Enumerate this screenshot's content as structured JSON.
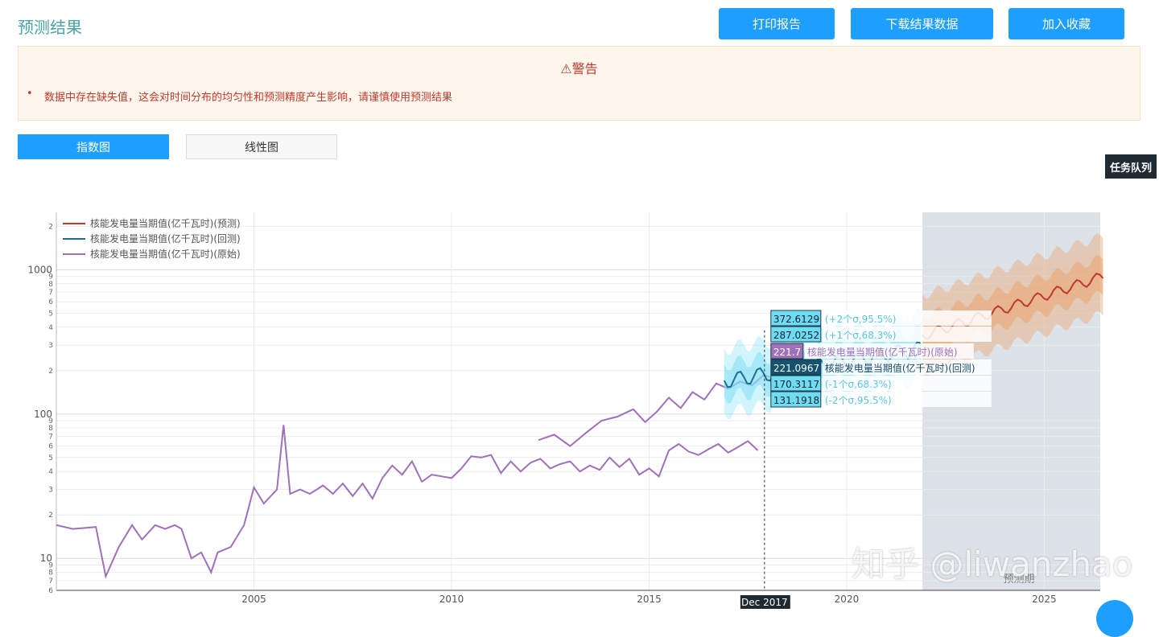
{
  "page": {
    "title": "预测结果",
    "buttons": {
      "print": "打印报告",
      "download": "下载结果数据",
      "favorite": "加入收藏"
    },
    "alert": {
      "title": "⚠警告",
      "message": "数据中存在缺失值，这会对时间分布的均匀性和预测精度产生影响，请谨慎使用预测结果"
    },
    "tabs": {
      "log": "指数图",
      "linear": "线性图"
    },
    "task_queue": "任务队列",
    "watermark": "知乎 @liwanzhao"
  },
  "colors": {
    "accent": "#1e9fff",
    "forecast": "#c0392b",
    "backtest": "#1a6f8f",
    "original": "#a070b8",
    "band_blue": "#7fe0f5",
    "band_orange": "#e9a877",
    "forecast_region": "#dde2e8"
  },
  "chart_data": {
    "type": "line",
    "y_scale": "log",
    "ylim": [
      6,
      2500
    ],
    "xlim": [
      "2000-01",
      "2026-06"
    ],
    "x_ticks": [
      "2005",
      "2010",
      "2015",
      "2020",
      "2025"
    ],
    "y_major_ticks": [
      {
        "value": 10,
        "label": "10"
      },
      {
        "value": 100,
        "label": "100"
      },
      {
        "value": 1000,
        "label": "1000"
      }
    ],
    "y_minor_labels": [
      "2",
      "3",
      "4",
      "5",
      "6",
      "7",
      "8",
      "9"
    ],
    "forecast_region": {
      "start": "2021-12",
      "label": "预测期"
    },
    "hover_x_label": "Dec 2017",
    "legend": {
      "placement": "top-left",
      "entries": [
        "核能发电量当期值(亿千瓦时)(预测)",
        "核能发电量当期值(亿千瓦时)(回测)",
        "核能发电量当期值(亿千瓦时)(原始)"
      ]
    },
    "tooltip": [
      {
        "value": "372.6129",
        "label": "(+2个σ,95.5%)",
        "kind": "band"
      },
      {
        "value": "287.0252",
        "label": "(+1个σ,68.3%)",
        "kind": "band"
      },
      {
        "value": "221.7",
        "label": "核能发电量当期值(亿千瓦时)(原始)",
        "kind": "original"
      },
      {
        "value": "221.0967",
        "label": "核能发电量当期值(亿千瓦时)(回测)",
        "kind": "backtest"
      },
      {
        "value": "170.3117",
        "label": "(-1个σ,68.3%)",
        "kind": "band"
      },
      {
        "value": "131.1918",
        "label": "(-2个σ,95.5%)",
        "kind": "band"
      }
    ],
    "original_series": [
      [
        "2000-01",
        17
      ],
      [
        "2000-06",
        16
      ],
      [
        "2001-01",
        16.5
      ],
      [
        "2001-04",
        7.5
      ],
      [
        "2001-08",
        12
      ],
      [
        "2001-12",
        17
      ],
      [
        "2002-03",
        13.5
      ],
      [
        "2002-07",
        17
      ],
      [
        "2002-10",
        16
      ],
      [
        "2003-01",
        17
      ],
      [
        "2003-03",
        16
      ],
      [
        "2003-06",
        10
      ],
      [
        "2003-09",
        11
      ],
      [
        "2003-12",
        8
      ],
      [
        "2004-02",
        11
      ],
      [
        "2004-06",
        12
      ],
      [
        "2004-10",
        17
      ],
      [
        "2005-01",
        31
      ],
      [
        "2005-04",
        24
      ],
      [
        "2005-08",
        30
      ],
      [
        "2005-10",
        84
      ],
      [
        "2005-12",
        28
      ],
      [
        "2006-03",
        30
      ],
      [
        "2006-06",
        28
      ],
      [
        "2006-10",
        32
      ],
      [
        "2007-01",
        28
      ],
      [
        "2007-04",
        33
      ],
      [
        "2007-07",
        27
      ],
      [
        "2007-10",
        33
      ],
      [
        "2008-01",
        26
      ],
      [
        "2008-04",
        36
      ],
      [
        "2008-07",
        44
      ],
      [
        "2008-10",
        38
      ],
      [
        "2009-01",
        47
      ],
      [
        "2009-04",
        34
      ],
      [
        "2009-07",
        38
      ],
      [
        "2009-10",
        37
      ],
      [
        "2010-01",
        36
      ],
      [
        "2010-04",
        42
      ],
      [
        "2010-07",
        51
      ],
      [
        "2010-10",
        50
      ],
      [
        "2011-01",
        52
      ],
      [
        "2011-04",
        39
      ],
      [
        "2011-07",
        47
      ],
      [
        "2011-10",
        40
      ],
      [
        "2012-01",
        46
      ],
      [
        "2012-04",
        49
      ],
      [
        "2012-07",
        42
      ],
      [
        "2012-10",
        45
      ],
      [
        "2013-01",
        47
      ],
      [
        "2013-04",
        40
      ],
      [
        "2013-07",
        44
      ],
      [
        "2013-10",
        41
      ],
      [
        "2014-01",
        50
      ],
      [
        "2014-04",
        43
      ],
      [
        "2014-07",
        49
      ],
      [
        "2014-10",
        38
      ],
      [
        "2015-01",
        42
      ],
      [
        "2015-04",
        37
      ],
      [
        "2015-07",
        56
      ],
      [
        "2015-10",
        62
      ],
      [
        "2016-01",
        55
      ],
      [
        "2016-04",
        52
      ],
      [
        "2016-07",
        57
      ],
      [
        "2016-10",
        62
      ],
      [
        "2017-01",
        54
      ],
      [
        "2017-04",
        59
      ],
      [
        "2017-07",
        65
      ],
      [
        "2017-10",
        56
      ]
    ]
  }
}
